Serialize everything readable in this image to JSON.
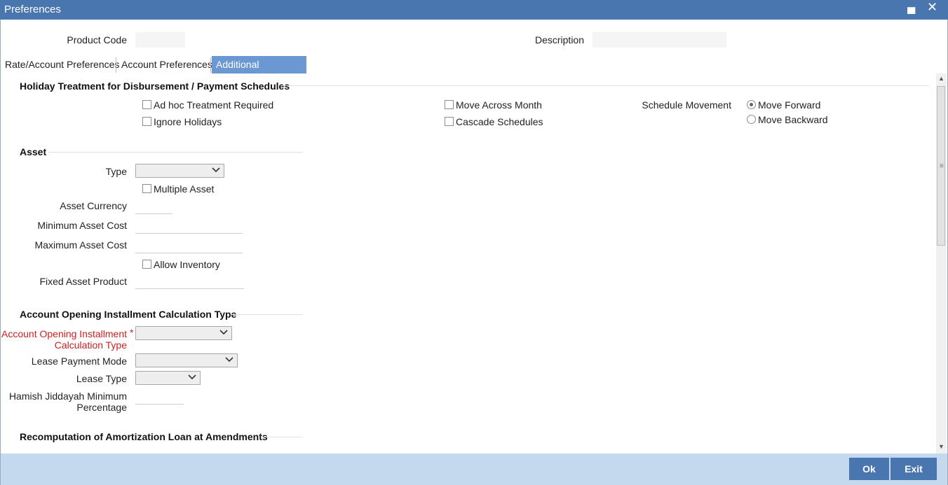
{
  "window": {
    "title": "Preferences",
    "minimize_glyph": "▄",
    "close_glyph": "✕"
  },
  "header": {
    "product_code_label": "Product Code",
    "product_code_value": "",
    "description_label": "Description",
    "description_value": ""
  },
  "tabs": [
    {
      "label": "Rate/Account Preferences",
      "active": false
    },
    {
      "label": "Account Preferences",
      "active": false
    },
    {
      "label": "Additional Preference",
      "active": true
    }
  ],
  "holiday": {
    "title": "Holiday Treatment for Disbursement / Payment Schedules",
    "adhoc_label": "Ad hoc Treatment Required",
    "adhoc_checked": false,
    "ignore_label": "Ignore Holidays",
    "ignore_checked": false,
    "move_across_label": "Move Across Month",
    "move_across_checked": false,
    "cascade_label": "Cascade Schedules",
    "cascade_checked": false,
    "schedule_movement_label": "Schedule Movement",
    "move_forward_label": "Move Forward",
    "move_forward_selected": true,
    "move_backward_label": "Move Backward",
    "move_backward_selected": false
  },
  "asset": {
    "title": "Asset",
    "type_label": "Type",
    "type_value": "",
    "multiple_asset_label": "Multiple Asset",
    "multiple_asset_checked": false,
    "currency_label": "Asset Currency",
    "currency_value": "",
    "min_cost_label": "Minimum Asset Cost",
    "min_cost_value": "",
    "max_cost_label": "Maximum Asset Cost",
    "max_cost_value": "",
    "allow_inventory_label": "Allow Inventory",
    "allow_inventory_checked": false,
    "fixed_asset_label": "Fixed Asset Product",
    "fixed_asset_value": ""
  },
  "installment": {
    "title": "Account Opening Installment Calculation Type",
    "calc_type_label_1": "Account Opening Installment",
    "calc_type_label_2": "Calculation Type",
    "required_mark": "*",
    "calc_type_value": "",
    "lease_mode_label": "Lease Payment Mode",
    "lease_mode_value": "",
    "lease_type_label": "Lease Type",
    "lease_type_value": "",
    "hamish_label_1": "Hamish Jiddayah Minimum",
    "hamish_label_2": "Percentage",
    "hamish_value": ""
  },
  "recomputation": {
    "title": "Recomputation of Amortization Loan at Amendments"
  },
  "icons": {
    "chevron": "chevron-down-icon",
    "scroll_up": "▲",
    "scroll_down": "▼",
    "grip": "≡"
  },
  "footer": {
    "ok_label": "Ok",
    "exit_label": "Exit"
  }
}
